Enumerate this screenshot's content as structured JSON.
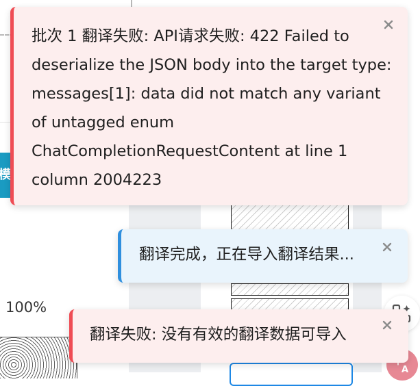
{
  "background": {
    "zoom_level": "100%",
    "mode_tab_glyph": "模"
  },
  "toasts": [
    {
      "type": "error",
      "message": "批次 1 翻译失败: API请求失败: 422 Failed to deserialize the JSON body into the target type: messages[1]: data did not match any variant of untagged enum ChatCompletionRequestContent at line 1 column 2004223",
      "close_icon": "close-icon",
      "color": "#ef4c54"
    },
    {
      "type": "info",
      "message": "翻译完成，正在导入翻译结果...",
      "close_icon": "close-icon",
      "color": "#2f8fde"
    },
    {
      "type": "error",
      "message": "翻译失败: 没有有效的翻译数据可导入",
      "close_icon": "close-icon",
      "color": "#ef4c54"
    }
  ],
  "floating_buttons": {
    "tools_icon": "apps-add-icon",
    "translate_icon": "translate-icon",
    "translate_color": "#e78894"
  }
}
